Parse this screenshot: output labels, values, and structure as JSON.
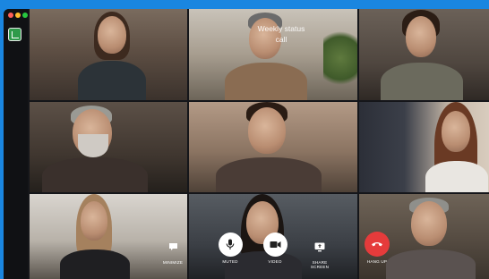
{
  "meeting": {
    "title": "Weekly status\ncall"
  },
  "participants": [
    {
      "id": "p1",
      "name": ""
    },
    {
      "id": "p2",
      "name": ""
    },
    {
      "id": "p3",
      "name": ""
    },
    {
      "id": "p4",
      "name": ""
    },
    {
      "id": "p5",
      "name": ""
    },
    {
      "id": "p6",
      "name": ""
    },
    {
      "id": "p7",
      "name": ""
    },
    {
      "id": "p8",
      "name": ""
    },
    {
      "id": "p9",
      "name": ""
    }
  ],
  "controls": {
    "minimize_label": "MINIMIZE",
    "mute_label": "MUTED",
    "video_label": "VIDEO",
    "share_label": "SHARE\nSCREEN",
    "hangup_label": "HANG UP"
  },
  "colors": {
    "hangup": "#e53b3b",
    "desktop": "#1a86e0",
    "app_badge": "#2f9a4a"
  }
}
